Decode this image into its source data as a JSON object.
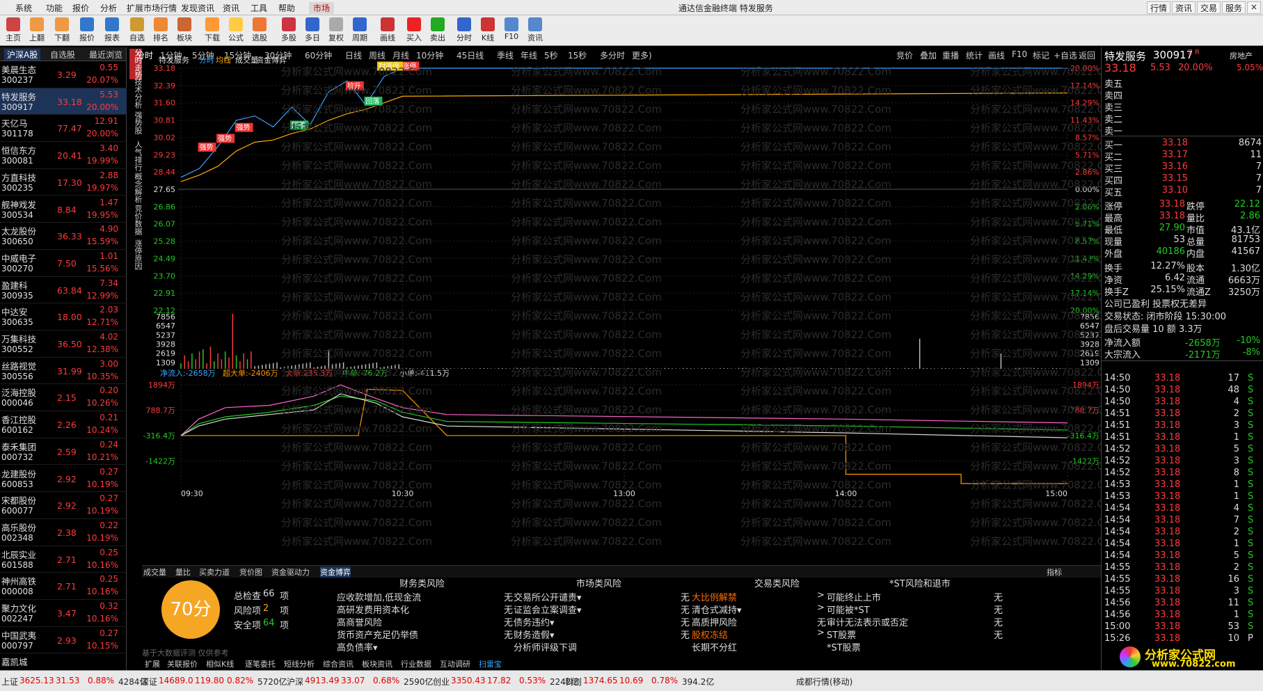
{
  "menu": [
    "系统",
    "功能",
    "报价",
    "分析",
    "扩展市场行情",
    "发现资讯",
    "资讯",
    "工具",
    "帮助",
    "市场"
  ],
  "window_title": "通达信金融终端  特发服务",
  "top_right_buttons": [
    "行情",
    "资讯",
    "交易",
    "服务"
  ],
  "toolbar": [
    "主页",
    "上翻",
    "下翻",
    "报价",
    "报表",
    "自选",
    "排名",
    "板块",
    "下载",
    "公式",
    "选股",
    "多股",
    "多日",
    "复权",
    "周期",
    "画线",
    "买入",
    "卖出",
    "分时",
    "K线",
    "F10",
    "资讯"
  ],
  "left_tabs": [
    "沪深A股",
    "自选股",
    "最近浏览"
  ],
  "stocks": [
    {
      "name": "美晨生态",
      "code": "300237",
      "price": "3.29",
      "chg": "0.55",
      "pct": "20.07%"
    },
    {
      "name": "特发服务",
      "code": "300917",
      "price": "33.18",
      "chg": "5.53",
      "pct": "20.00%"
    },
    {
      "name": "天亿马",
      "code": "301178",
      "price": "77.47",
      "chg": "12.91",
      "pct": "20.00%"
    },
    {
      "name": "恒信东方",
      "code": "300081",
      "price": "20.41",
      "chg": "3.40",
      "pct": "19.99%"
    },
    {
      "name": "方直科技",
      "code": "300235",
      "price": "17.30",
      "chg": "2.88",
      "pct": "19.97%"
    },
    {
      "name": "舰神戏发",
      "code": "300534",
      "price": "8.84",
      "chg": "1.47",
      "pct": "19.95%"
    },
    {
      "name": "太龙股份",
      "code": "300650",
      "price": "36.33",
      "chg": "4.90",
      "pct": "15.59%"
    },
    {
      "name": "中威电子",
      "code": "300270",
      "price": "7.50",
      "chg": "1.01",
      "pct": "15.56%"
    },
    {
      "name": "盈建科",
      "code": "300935",
      "price": "63.84",
      "chg": "7.34",
      "pct": "12.99%"
    },
    {
      "name": "中达安",
      "code": "300635",
      "price": "18.00",
      "chg": "2.03",
      "pct": "12.71%"
    },
    {
      "name": "万集科技",
      "code": "300552",
      "price": "36.50",
      "chg": "4.02",
      "pct": "12.38%"
    },
    {
      "name": "丝路视觉",
      "code": "300556",
      "price": "31.99",
      "chg": "3.00",
      "pct": "10.35%"
    },
    {
      "name": "泛海控股",
      "code": "000046",
      "price": "2.15",
      "chg": "0.20",
      "pct": "10.26%"
    },
    {
      "name": "香江控股",
      "code": "600162",
      "price": "2.26",
      "chg": "0.21",
      "pct": "10.24%"
    },
    {
      "name": "泰禾集团",
      "code": "000732",
      "price": "2.59",
      "chg": "0.24",
      "pct": "10.21%"
    },
    {
      "name": "龙建股份",
      "code": "600853",
      "price": "2.92",
      "chg": "0.27",
      "pct": "10.19%"
    },
    {
      "name": "宋都股份",
      "code": "600077",
      "price": "2.92",
      "chg": "0.27",
      "pct": "10.19%"
    },
    {
      "name": "高乐股份",
      "code": "002348",
      "price": "2.38",
      "chg": "0.22",
      "pct": "10.19%"
    },
    {
      "name": "北辰实业",
      "code": "601588",
      "price": "2.71",
      "chg": "0.25",
      "pct": "10.16%"
    },
    {
      "name": "神州高铁",
      "code": "000008",
      "price": "2.71",
      "chg": "0.25",
      "pct": "10.16%"
    },
    {
      "name": "聚力文化",
      "code": "002247",
      "price": "3.47",
      "chg": "0.32",
      "pct": "10.16%"
    },
    {
      "name": "中国武夷",
      "code": "000797",
      "price": "2.93",
      "chg": "0.27",
      "pct": "10.15%"
    },
    {
      "name": "嘉凯城",
      "code": "",
      "price": "",
      "chg": "",
      "pct": ""
    }
  ],
  "vtabs": [
    "分时走势",
    "技术分析",
    "强势股",
    "人气排行",
    "概念解析",
    "竞价数据",
    "涨停原因"
  ],
  "period_tabs": [
    "分时",
    "1分钟",
    "5分钟",
    "15分钟",
    "30分钟",
    "60分钟",
    "日线",
    "周线",
    "月线",
    "10分钟",
    "45日线",
    "季线",
    "年线",
    "5秒",
    "15秒",
    "多分时",
    "更多)"
  ],
  "right_tools": [
    "竞价",
    "叠加",
    "重播",
    "统计",
    "画线",
    "F10",
    "标记",
    "+自选",
    "返回"
  ],
  "chart_legend": [
    "特发服务",
    "分时",
    "均线",
    "成交量",
    "资金博弈"
  ],
  "price_axis_left": [
    "33.18",
    "32.39",
    "31.60",
    "30.81",
    "30.02",
    "29.23",
    "28.44",
    "27.65",
    "26.86",
    "26.07",
    "25.28",
    "24.49",
    "23.70",
    "22.91",
    "22.12"
  ],
  "price_axis_right": [
    "20.00%",
    "17.14%",
    "14.29%",
    "11.43%",
    "8.57%",
    "5.71%",
    "2.86%",
    "0.00%",
    "2.86%",
    "5.71%",
    "8.57%",
    "11.43%",
    "14.29%",
    "17.14%",
    "20.00%"
  ],
  "vol_axis": [
    "7856",
    "6547",
    "5237",
    "3928",
    "2619",
    "1309"
  ],
  "flow_axis": [
    "1894万",
    "788.7万",
    "-316.4万",
    "-1422万"
  ],
  "flow_legend": [
    "净流入:-2658万",
    "超大单:-2406万",
    "大单:235.3万",
    "中单:-76.2万",
    "小单:-411.5万"
  ],
  "annotations": [
    "涨停",
    "封涨停",
    "强势",
    "回落",
    "拉升",
    "回调"
  ],
  "time_axis": [
    "09:30",
    "10:30",
    "13:00",
    "14:00",
    "15:00"
  ],
  "chart_bottom_tabs": [
    "成交量",
    "量比",
    "买卖力道",
    "竞价图",
    "资金驱动力",
    "资金博弈"
  ],
  "chart_bottom_right": "指标",
  "stock_header": {
    "name": "特发服务",
    "code": "300917",
    "tag": "Z R",
    "industry": "房地产",
    "price": "33.18",
    "chg": "5.53",
    "pct": "20.00%",
    "pct2": "5.05%"
  },
  "asks": [
    {
      "l": "卖五",
      "v": "",
      "q": ""
    },
    {
      "l": "卖四",
      "v": "",
      "q": ""
    },
    {
      "l": "卖三",
      "v": "",
      "q": ""
    },
    {
      "l": "卖二",
      "v": "",
      "q": ""
    },
    {
      "l": "卖一",
      "v": "",
      "q": ""
    }
  ],
  "bids": [
    {
      "l": "买一",
      "v": "33.18",
      "q": "8674"
    },
    {
      "l": "买二",
      "v": "33.17",
      "q": "11"
    },
    {
      "l": "买三",
      "v": "33.16",
      "q": "7"
    },
    {
      "l": "买四",
      "v": "33.15",
      "q": "7"
    },
    {
      "l": "买五",
      "v": "33.10",
      "q": "7"
    }
  ],
  "stats": [
    [
      "涨停",
      "33.18",
      "跌停",
      "22.12"
    ],
    [
      "最高",
      "33.18",
      "量比",
      "2.86"
    ],
    [
      "最低",
      "27.90",
      "市值",
      "43.1亿"
    ],
    [
      "现量",
      "53",
      "总量",
      "81753"
    ],
    [
      "外盘",
      "40186",
      "内盘",
      "41567"
    ],
    [
      "换手",
      "12.27%",
      "股本",
      "1.30亿"
    ],
    [
      "净资",
      "6.42",
      "流通",
      "6663万"
    ],
    [
      "换手Z",
      "25.15%",
      "流通Z",
      "3250万"
    ]
  ],
  "info_lines": [
    "公司已盈利 投票权无差异",
    "交易状态: 闭市阶段 15:30:00",
    "盘后交易量 10 额 3.3万"
  ],
  "flows": [
    {
      "l": "净流入额",
      "v": "-2658万",
      "p": "-10%"
    },
    {
      "l": "大宗流入",
      "v": "-2171万",
      "p": "-8%"
    }
  ],
  "ticks": [
    {
      "t": "14:50",
      "p": "33.18",
      "n": "17",
      "f": "S"
    },
    {
      "t": "14:50",
      "p": "33.18",
      "n": "48",
      "f": "S"
    },
    {
      "t": "14:50",
      "p": "33.18",
      "n": "4",
      "f": "S"
    },
    {
      "t": "14:51",
      "p": "33.18",
      "n": "2",
      "f": "S"
    },
    {
      "t": "14:51",
      "p": "33.18",
      "n": "3",
      "f": "S"
    },
    {
      "t": "14:51",
      "p": "33.18",
      "n": "1",
      "f": "S"
    },
    {
      "t": "14:52",
      "p": "33.18",
      "n": "5",
      "f": "S"
    },
    {
      "t": "14:52",
      "p": "33.18",
      "n": "3",
      "f": "S"
    },
    {
      "t": "14:52",
      "p": "33.18",
      "n": "8",
      "f": "S"
    },
    {
      "t": "14:53",
      "p": "33.18",
      "n": "1",
      "f": "S"
    },
    {
      "t": "14:53",
      "p": "33.18",
      "n": "1",
      "f": "S"
    },
    {
      "t": "14:54",
      "p": "33.18",
      "n": "4",
      "f": "S"
    },
    {
      "t": "14:54",
      "p": "33.18",
      "n": "7",
      "f": "S"
    },
    {
      "t": "14:54",
      "p": "33.18",
      "n": "2",
      "f": "S"
    },
    {
      "t": "14:54",
      "p": "33.18",
      "n": "1",
      "f": "S"
    },
    {
      "t": "14:54",
      "p": "33.18",
      "n": "5",
      "f": "S"
    },
    {
      "t": "14:55",
      "p": "33.18",
      "n": "2",
      "f": "S"
    },
    {
      "t": "14:55",
      "p": "33.18",
      "n": "16",
      "f": "S"
    },
    {
      "t": "14:55",
      "p": "33.18",
      "n": "3",
      "f": "S"
    },
    {
      "t": "14:56",
      "p": "33.18",
      "n": "11",
      "f": "S"
    },
    {
      "t": "14:56",
      "p": "33.18",
      "n": "1",
      "f": "S"
    },
    {
      "t": "15:00",
      "p": "33.18",
      "n": "53",
      "f": "S"
    },
    {
      "t": "15:26",
      "p": "33.18",
      "n": "10",
      "f": "P"
    }
  ],
  "risk": {
    "score": "70分",
    "note": "基于大数据评测 仅供参考",
    "summary": [
      {
        "l": "总检查",
        "v": "66",
        "u": "项"
      },
      {
        "l": "风险项",
        "v": "2",
        "u": "项"
      },
      {
        "l": "安全项",
        "v": "64",
        "u": "项"
      }
    ],
    "col_titles": [
      "财务类风险",
      "市场类风险",
      "交易类风险",
      "*ST风险和退市"
    ],
    "col1": [
      [
        "应收款增加,低现金流",
        "无"
      ],
      [
        "高研发费用资本化",
        "无"
      ],
      [
        "高商誉风险",
        "无"
      ],
      [
        "货币资产充足仍举债",
        "无"
      ],
      [
        "高负债率▾",
        ""
      ]
    ],
    "col2": [
      [
        "交易所公开谴责▾",
        "无"
      ],
      [
        "证监会立案调查▾",
        "无"
      ],
      [
        "债务违约▾",
        "无"
      ],
      [
        "财务造假▾",
        "无"
      ],
      [
        "分析师评级下调",
        ""
      ]
    ],
    "col3": [
      [
        "大比例解禁",
        ">"
      ],
      [
        "清仓式减持▾",
        ">"
      ],
      [
        "高质押风险",
        "无"
      ],
      [
        "股权冻结",
        ">"
      ],
      [
        "长期不分红",
        ""
      ]
    ],
    "col4": [
      [
        "可能终止上市",
        "无"
      ],
      [
        "可能被*ST",
        "无"
      ],
      [
        "审计无法表示或否定",
        "无"
      ],
      [
        "ST股票",
        "无"
      ],
      [
        "*ST股票",
        ""
      ]
    ]
  },
  "bottom_tabs": [
    "扩展",
    "关联报价",
    "相似K线",
    "逐笔委托",
    "短线分析",
    "综合资讯",
    "板块资讯",
    "行业数据",
    "互动调研",
    "扫雷宝"
  ],
  "status": [
    {
      "k": "上证",
      "v": "3625.13",
      "c": "31.53",
      "p": "0.88%",
      "a": "4284亿"
    },
    {
      "k": "深证",
      "v": "14689.0",
      "c": "119.80",
      "p": "0.82%",
      "a": "5720亿"
    },
    {
      "k": "沪深",
      "v": "4913.49",
      "c": "33.07",
      "p": "0.68%",
      "a": "2590亿"
    },
    {
      "k": "创业",
      "v": "3350.43",
      "c": "17.82",
      "p": "0.53%",
      "a": "2242亿"
    },
    {
      "k": "科创",
      "v": "1374.65",
      "c": "10.69",
      "p": "0.78%",
      "a": "394.2亿"
    }
  ],
  "status_right": "成都行情(移动)",
  "logo": {
    "text": "分析家公式网",
    "url": "www.70822.com"
  },
  "watermark": "分析家公式网www.70822.Com",
  "chart_data": {
    "type": "line",
    "title": "特发服务 分时",
    "ylim": [
      22.12,
      33.18
    ],
    "prev_close": 27.65,
    "x": [
      "09:30",
      "09:35",
      "09:40",
      "09:45",
      "09:50",
      "09:55",
      "10:00",
      "10:05",
      "10:10",
      "10:15",
      "10:20",
      "10:25",
      "10:30",
      "15:00"
    ],
    "series": [
      {
        "name": "分时",
        "values": [
          28.2,
          28.6,
          29.6,
          30.8,
          31.0,
          30.5,
          31.4,
          30.6,
          32.1,
          32.6,
          31.5,
          32.8,
          33.18,
          33.18
        ]
      },
      {
        "name": "均线",
        "values": [
          28.0,
          28.3,
          28.7,
          29.4,
          29.8,
          29.9,
          30.2,
          30.4,
          30.8,
          31.1,
          31.3,
          31.6,
          31.9,
          32.05
        ]
      }
    ],
    "volume_peak": 7856,
    "flow_series": [
      {
        "name": "超大单",
        "values": [
          -316,
          0,
          300,
          400,
          500,
          1700,
          1800,
          1700,
          -316,
          -316,
          -2406
        ]
      },
      {
        "name": "大单",
        "values": [
          -316,
          400,
          900,
          1000,
          1400,
          1894,
          1300,
          900,
          600,
          400,
          235
        ]
      },
      {
        "name": "中单",
        "values": [
          -316,
          200,
          500,
          700,
          1000,
          1400,
          1200,
          700,
          300,
          100,
          -76
        ]
      },
      {
        "name": "小单",
        "values": [
          -316,
          100,
          400,
          600,
          800,
          1500,
          1100,
          500,
          100,
          -200,
          -411
        ]
      }
    ]
  }
}
